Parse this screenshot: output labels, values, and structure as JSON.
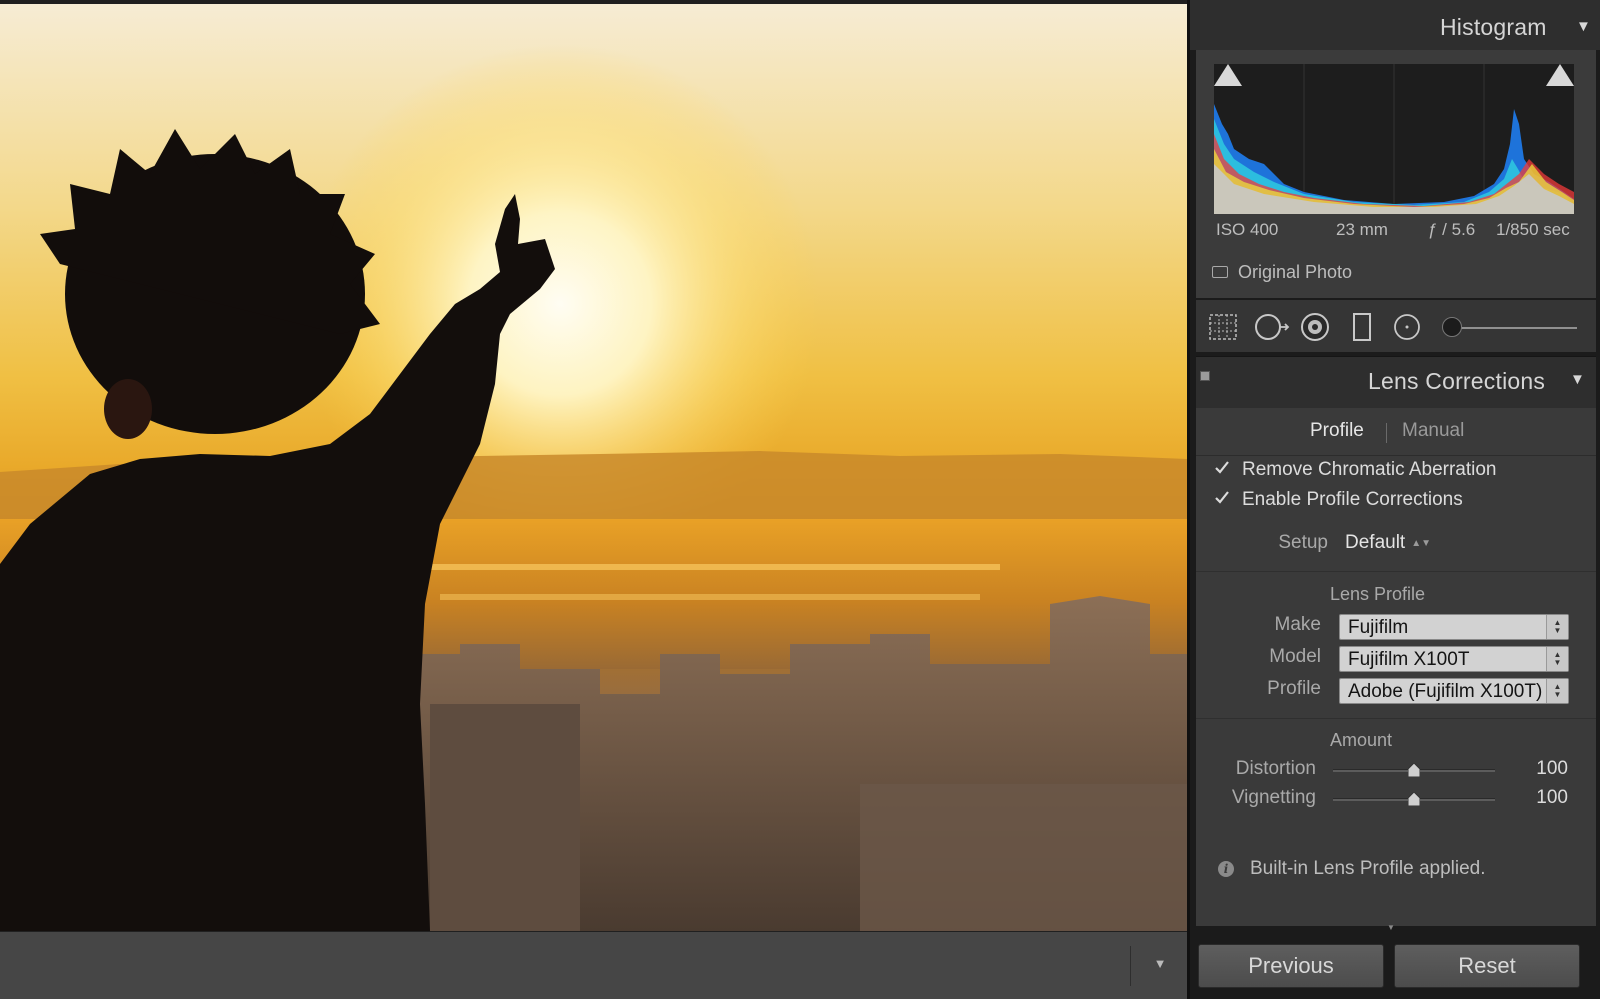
{
  "histogram": {
    "title": "Histogram",
    "exif": {
      "iso": "ISO 400",
      "focal": "23 mm",
      "aperture": "ƒ / 5.6",
      "shutter": "1/850 sec"
    },
    "original_photo_label": "Original Photo"
  },
  "tools": [
    "crop-overlay",
    "spot-removal",
    "red-eye",
    "graduated-filter",
    "radial-filter",
    "adjustment-brush"
  ],
  "lens_corrections": {
    "title": "Lens Corrections",
    "tabs": [
      "Profile",
      "Manual"
    ],
    "active_tab": "Profile",
    "remove_ca": {
      "label": "Remove Chromatic Aberration",
      "checked": true
    },
    "enable_profile": {
      "label": "Enable Profile Corrections",
      "checked": true
    },
    "setup": {
      "label": "Setup",
      "value": "Default"
    },
    "lens_profile": {
      "heading": "Lens Profile",
      "make": {
        "label": "Make",
        "value": "Fujifilm"
      },
      "model": {
        "label": "Model",
        "value": "Fujifilm X100T"
      },
      "profile": {
        "label": "Profile",
        "value": "Adobe (Fujifilm X100T)"
      }
    },
    "amount": {
      "heading": "Amount",
      "distortion": {
        "label": "Distortion",
        "value": "100",
        "position": 0.5
      },
      "vignetting": {
        "label": "Vignetting",
        "value": "100",
        "position": 0.5
      }
    },
    "info": "Built-in Lens Profile applied."
  },
  "buttons": {
    "previous": "Previous",
    "reset": "Reset"
  },
  "colors": {
    "panel_bg": "#3a3a3a",
    "header_bg": "#2e2e2e",
    "dark_bg": "#1b1b1b"
  }
}
